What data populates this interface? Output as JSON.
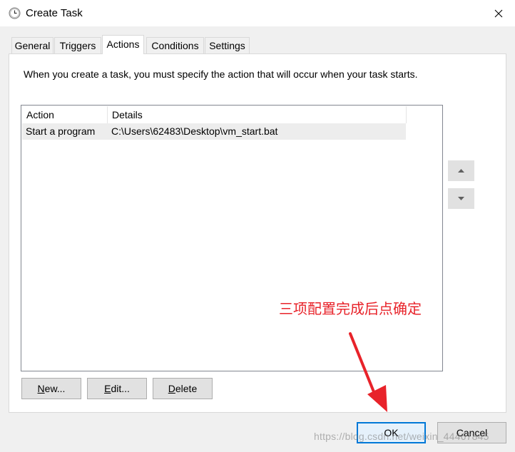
{
  "window": {
    "title": "Create Task",
    "close_icon": "close-icon"
  },
  "tabs": [
    {
      "label": "General",
      "active": false
    },
    {
      "label": "Triggers",
      "active": false
    },
    {
      "label": "Actions",
      "active": true
    },
    {
      "label": "Conditions",
      "active": false
    },
    {
      "label": "Settings",
      "active": false
    }
  ],
  "actions_tab": {
    "description": "When you create a task, you must specify the action that will occur when your task starts.",
    "columns": [
      "Action",
      "Details"
    ],
    "rows": [
      {
        "action": "Start a program",
        "details": "C:\\Users\\62483\\Desktop\\vm_start.bat"
      }
    ],
    "buttons": {
      "new_mnemonic": "N",
      "new_rest": "ew...",
      "edit_mnemonic": "E",
      "edit_rest": "dit...",
      "delete_mnemonic": "D",
      "delete_rest": "elete"
    },
    "move_up_icon": "triangle-up-icon",
    "move_down_icon": "triangle-down-icon"
  },
  "footer": {
    "ok_label": "OK",
    "cancel_label": "Cancel"
  },
  "annotation": {
    "text": "三项配置完成后点确定",
    "color": "#e8232a"
  },
  "watermark": "https://blog.csdn.net/weixin_44467845",
  "colors": {
    "accent": "#0078d7",
    "selected_row": "#ededed"
  }
}
